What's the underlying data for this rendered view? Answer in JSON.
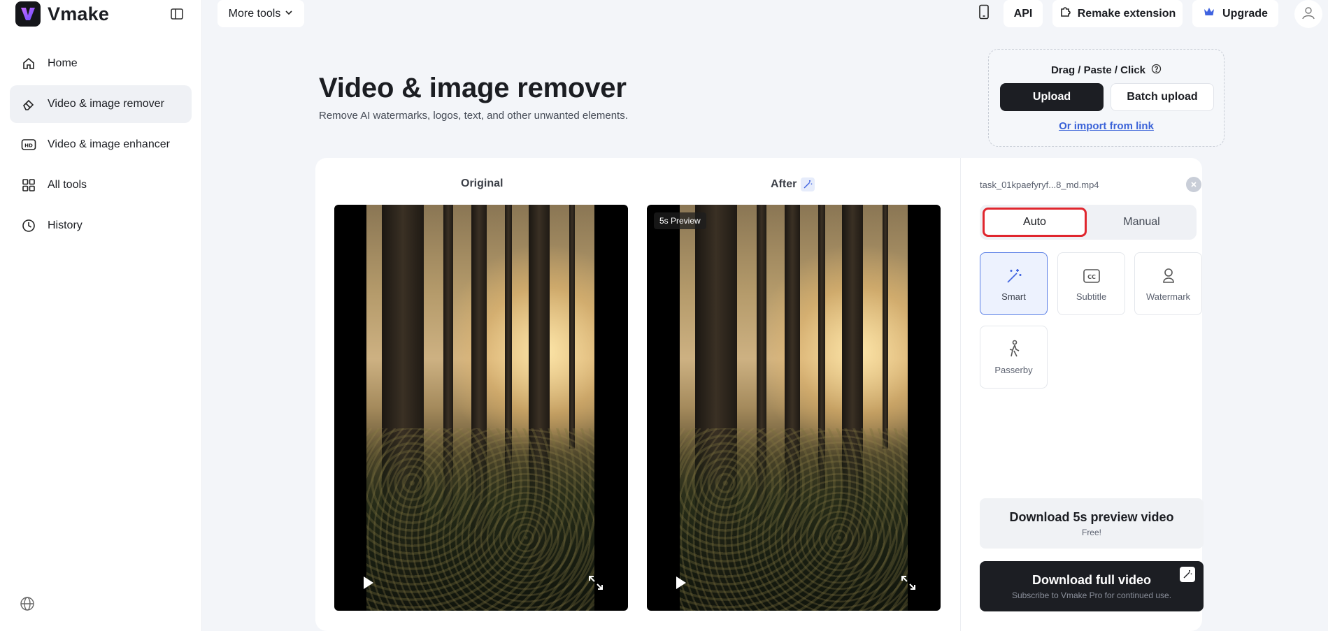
{
  "app": {
    "name": "Vmake"
  },
  "sidebar": {
    "items": [
      {
        "label": "Home",
        "icon": "home-icon"
      },
      {
        "label": "Video & image remover",
        "icon": "eraser-icon",
        "active": true
      },
      {
        "label": "Video & image enhancer",
        "icon": "hd-icon"
      },
      {
        "label": "All tools",
        "icon": "grid-icon"
      },
      {
        "label": "History",
        "icon": "clock-icon"
      }
    ]
  },
  "topbar": {
    "more_tools_label": "More tools",
    "api_label": "API",
    "remake_label": "Remake extension",
    "upgrade_label": "Upgrade"
  },
  "hero": {
    "title": "Video & image remover",
    "subtitle": "Remove AI watermarks, logos, text, and other unwanted elements."
  },
  "upload": {
    "drop_label": "Drag / Paste / Click",
    "upload_label": "Upload",
    "batch_label": "Batch upload",
    "import_label": "Or import from link"
  },
  "preview": {
    "original_label": "Original",
    "after_label": "After",
    "preview_tag": "5s Preview"
  },
  "panel": {
    "file_name": "task_01kpaefyryf...8_md.mp4",
    "modes": {
      "auto": "Auto",
      "manual": "Manual",
      "selected": "Auto"
    },
    "tools": [
      {
        "label": "Smart",
        "icon": "magic-wand-icon",
        "active": true
      },
      {
        "label": "Subtitle",
        "icon": "cc-icon"
      },
      {
        "label": "Watermark",
        "icon": "watermark-icon"
      },
      {
        "label": "Passerby",
        "icon": "walking-person-icon"
      }
    ],
    "download_preview": {
      "title": "Download 5s preview video",
      "sub": "Free!"
    },
    "download_full": {
      "title": "Download full video",
      "sub": "Subscribe to Vmake Pro for continued use."
    }
  },
  "colors": {
    "accent": "#3b63d8",
    "dark_button": "#1c1e23",
    "highlight_border": "#e0262e",
    "active_tile": "#edf2fe"
  }
}
